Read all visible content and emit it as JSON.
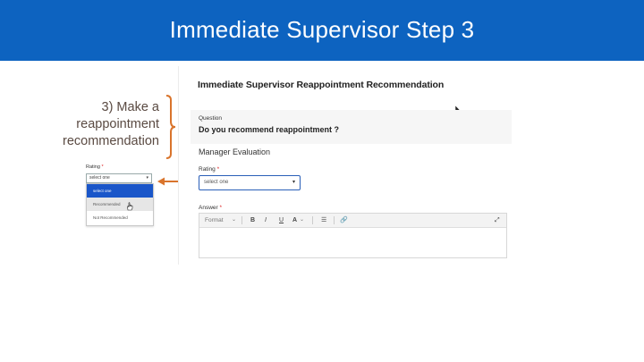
{
  "header": {
    "title": "Immediate Supervisor Step 3"
  },
  "step": {
    "line1": "3) Make a",
    "line2": "reappointment",
    "line3": "recommendation"
  },
  "mini_dropdown": {
    "label": "Rating",
    "required_mark": "*",
    "selected_value": "select one",
    "options": [
      "select one",
      "Recommended",
      "Not Recommended"
    ]
  },
  "form": {
    "title": "Immediate Supervisor Reappointment Recommendation",
    "question_label": "Question",
    "question_text": "Do you recommend reappointment ?",
    "section_title": "Manager Evaluation",
    "rating_label": "Rating",
    "required_mark": "*",
    "rating_value": "select one",
    "answer_label": "Answer",
    "toolbar": {
      "format": "Format",
      "bold": "B",
      "italic": "I",
      "underline": "U"
    }
  },
  "colors": {
    "header_bg": "#0d63c0",
    "accent_orange": "#d9742c",
    "select_border": "#2a5fb8",
    "required_red": "#dd2222"
  },
  "icons": [
    "chevron-down-icon",
    "font-color-icon",
    "bullet-list-icon",
    "link-icon",
    "expand-icon",
    "hand-cursor-icon",
    "arrow-cursor-icon"
  ]
}
